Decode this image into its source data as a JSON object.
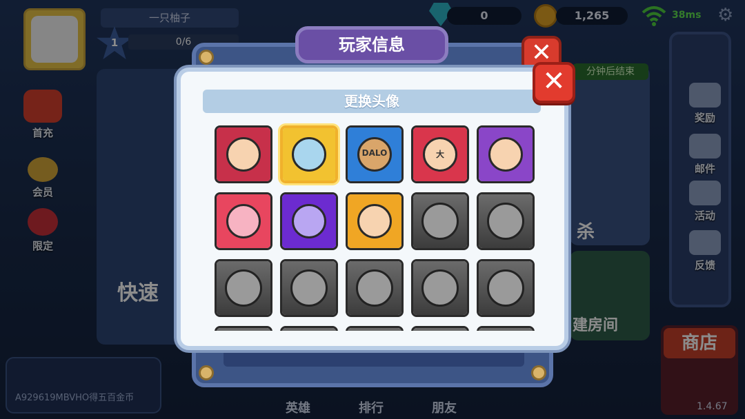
{
  "hud": {
    "player_name": "一只柚子",
    "level": "1",
    "exp": "0/6",
    "gems": "0",
    "coins": "1,265",
    "ping": "38ms"
  },
  "left_menu": [
    "首充",
    "会员",
    "限定"
  ],
  "right_menu": [
    "奖励",
    "邮件",
    "活动",
    "反馈"
  ],
  "banner": {
    "timer": "分钟后结束",
    "quick_match": "快速",
    "kill_mode": "杀",
    "create_room": "建房间",
    "shop": "商店"
  },
  "chat": {
    "message": "A929619MBVHO得五百金币"
  },
  "bottom_tabs": [
    "英雄",
    "排行",
    "朋友"
  ],
  "version": "1.4.67",
  "player_info_panel": {
    "title": "玩家信息",
    "close_symbol": "✕"
  },
  "avatar_modal": {
    "title": "更换头像",
    "close_symbol": "✕",
    "avatars": [
      {
        "name": "angry-blond-hero",
        "locked": false,
        "bg": "#c7304a"
      },
      {
        "name": "blue-bear",
        "locked": false,
        "bg": "#f2c230",
        "selected": true
      },
      {
        "name": "box-head",
        "locked": false,
        "bg": "#2f7fd8",
        "label": "DALO"
      },
      {
        "name": "scroll-bird",
        "locked": false,
        "bg": "#d9364c",
        "label": "大"
      },
      {
        "name": "bald-monk",
        "locked": false,
        "bg": "#8a46c8"
      },
      {
        "name": "cat-paw",
        "locked": false,
        "bg": "#e8465f"
      },
      {
        "name": "purple-goggles",
        "locked": false,
        "bg": "#6c2bd0"
      },
      {
        "name": "golden-star-kid",
        "locked": false,
        "bg": "#f0a624"
      },
      {
        "name": "helmet-girl",
        "locked": true
      },
      {
        "name": "samurai-mask",
        "locked": true
      },
      {
        "name": "hooded-girl",
        "locked": true
      },
      {
        "name": "top-hat-pirate",
        "locked": true
      },
      {
        "name": "robot-bear",
        "locked": true
      },
      {
        "name": "maid-girl",
        "locked": true
      },
      {
        "name": "skull-monster",
        "locked": true
      },
      {
        "name": "locked-16",
        "locked": true
      },
      {
        "name": "locked-17",
        "locked": true
      },
      {
        "name": "locked-18",
        "locked": true
      },
      {
        "name": "locked-19",
        "locked": true
      },
      {
        "name": "locked-20",
        "locked": true
      }
    ]
  }
}
